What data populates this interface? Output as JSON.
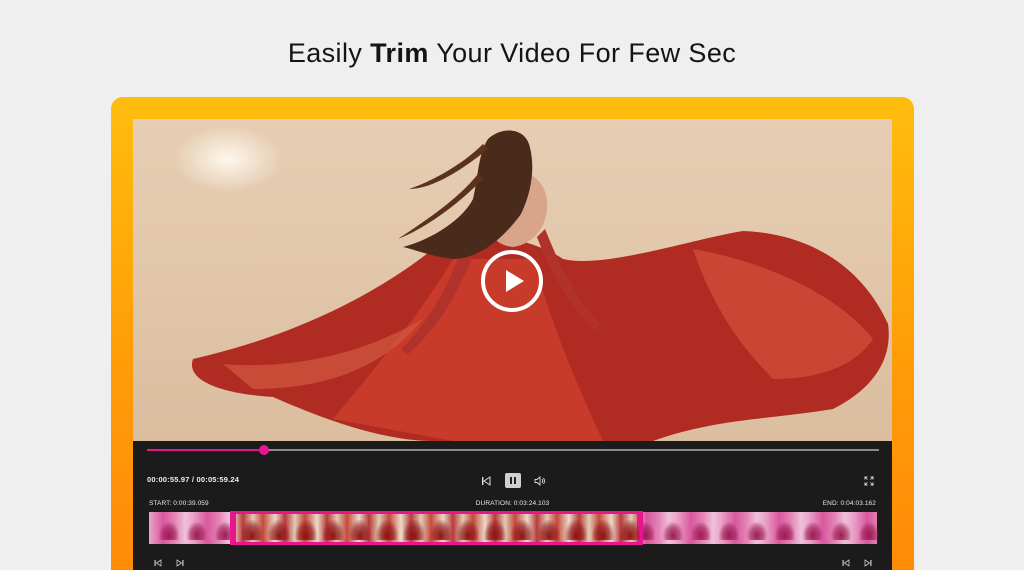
{
  "headline": {
    "pre": "Easily ",
    "bold": "Trim",
    "post": " Your Video For Few Sec"
  },
  "player": {
    "time_display": "00:00:55.97 / 00:05:59.24",
    "start_label": "START: 0:00:39.059",
    "duration_label": "DURATION: 0:03:24.103",
    "end_label": "END: 0:04:03.162",
    "progress_fraction": 0.16,
    "selection_start_fraction": 0.11,
    "selection_end_fraction": 0.67
  },
  "colors": {
    "accent": "#e8168e",
    "frame_top": "#ffbd0e",
    "frame_bottom": "#ff8a07",
    "page_bg": "#efefef",
    "controls_bg": "#1b1b1b"
  },
  "icons": {
    "big_play": "play-circle-icon",
    "prev": "skip-previous-icon",
    "pause": "pause-icon",
    "volume": "volume-icon",
    "fullscreen": "fullscreen-icon"
  }
}
